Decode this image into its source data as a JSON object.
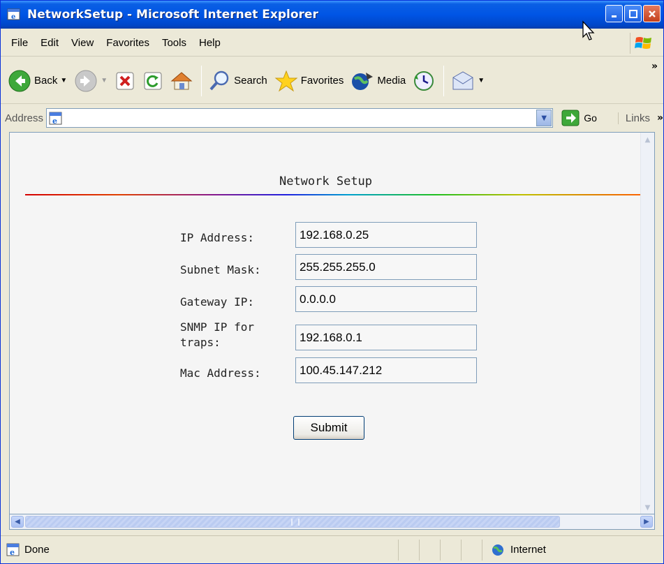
{
  "window": {
    "title": "NetworkSetup - Microsoft Internet Explorer"
  },
  "menu": [
    "File",
    "Edit",
    "View",
    "Favorites",
    "Tools",
    "Help"
  ],
  "toolbar": {
    "back_label": "Back",
    "search_label": "Search",
    "favorites_label": "Favorites",
    "media_label": "Media"
  },
  "address": {
    "label": "Address",
    "value": "",
    "go_label": "Go",
    "links_label": "Links"
  },
  "page": {
    "title": "Network Setup",
    "fields": [
      {
        "label": "IP Address:",
        "value": "192.168.0.25"
      },
      {
        "label": "Subnet Mask:",
        "value": "255.255.255.0"
      },
      {
        "label": "Gateway IP:",
        "value": "0.0.0.0"
      },
      {
        "label": "SNMP IP for traps:",
        "value": "192.168.0.1"
      },
      {
        "label": "Mac Address:",
        "value": "100.45.147.212"
      }
    ],
    "submit_label": "Submit"
  },
  "status": {
    "text": "Done",
    "zone": "Internet"
  }
}
